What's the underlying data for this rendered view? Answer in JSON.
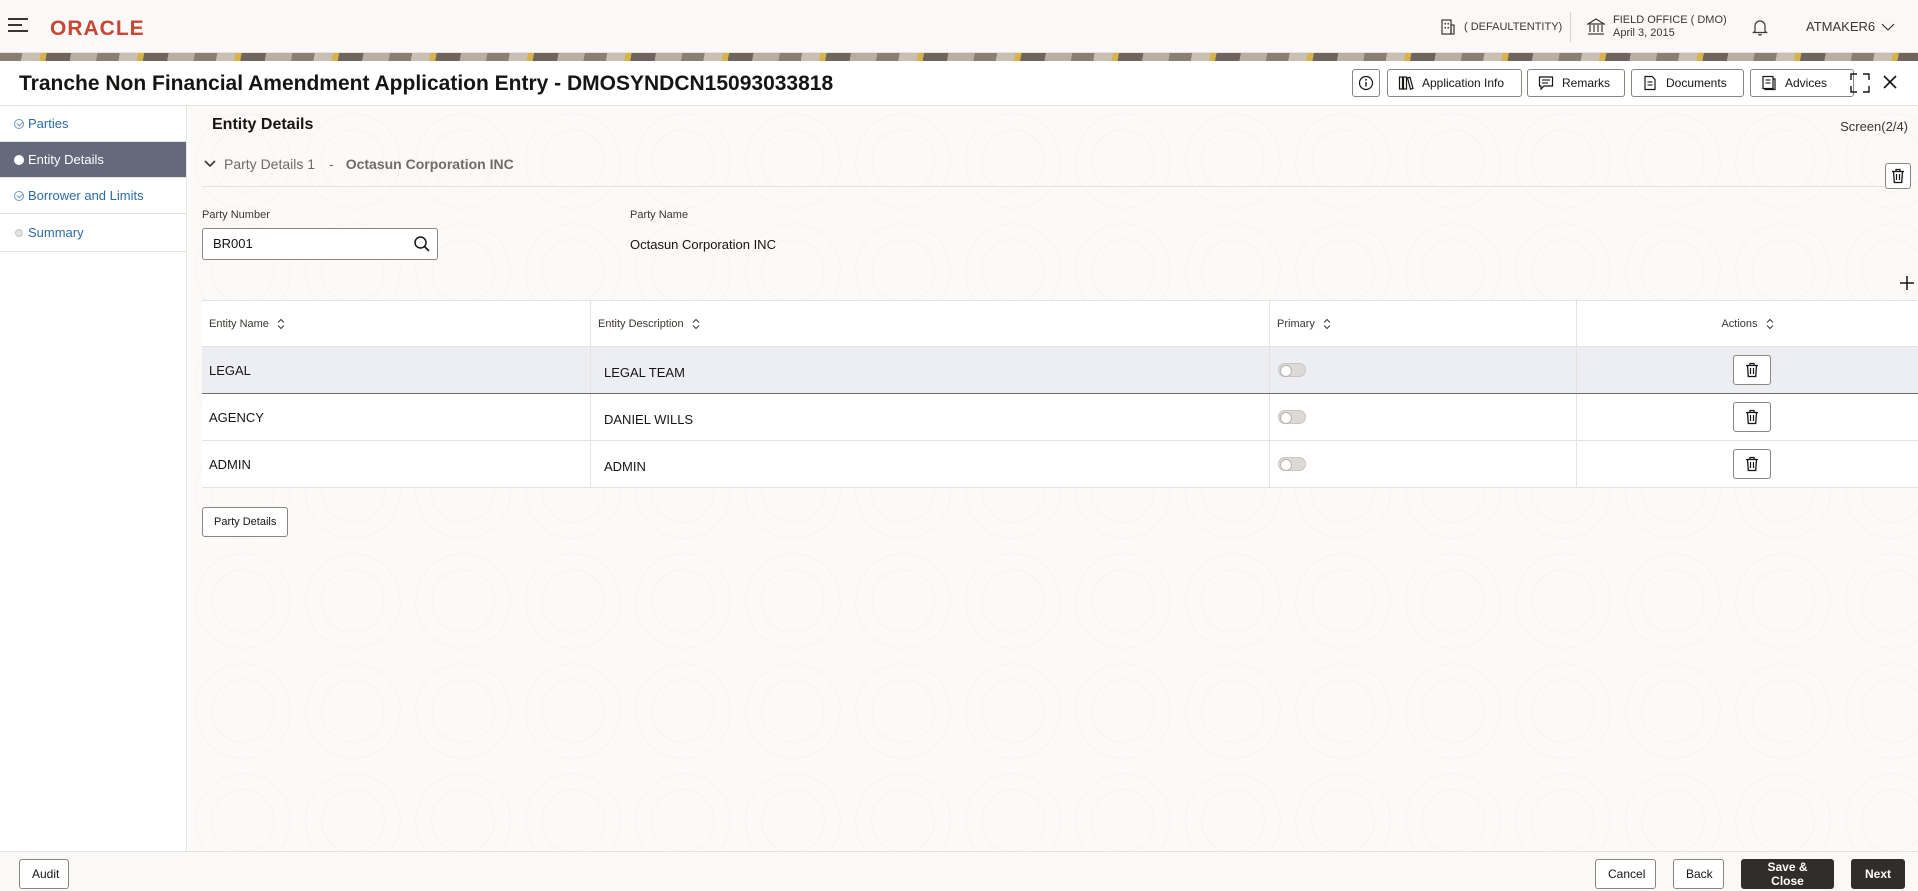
{
  "header": {
    "logo": "ORACLE",
    "entity": "( DEFAULTENTITY)",
    "office_line1": "FIELD OFFICE ( DMO)",
    "office_line2": "April 3, 2015",
    "user": "ATMAKER6"
  },
  "titlebar": {
    "title": "Tranche Non Financial Amendment Application Entry - DMOSYNDCN15093033818",
    "buttons": {
      "application_info": "Application Info",
      "remarks": "Remarks",
      "documents": "Documents",
      "advices": "Advices"
    }
  },
  "sidebar": {
    "items": [
      {
        "label": "Parties",
        "state": "done"
      },
      {
        "label": "Entity Details",
        "state": "active"
      },
      {
        "label": "Borrower and Limits",
        "state": "done"
      },
      {
        "label": "Summary",
        "state": "pending"
      }
    ]
  },
  "main": {
    "section_title": "Entity Details",
    "screen_count": "Screen(2/4)",
    "party_header_label": "Party Details  1",
    "party_header_sep": "-",
    "party_header_name": "Octasun Corporation INC",
    "party_number_label": "Party Number",
    "party_number_value": "BR001",
    "party_name_label": "Party Name",
    "party_name_value": "Octasun Corporation INC",
    "party_details_button": "Party Details"
  },
  "table": {
    "headers": [
      "Entity Name",
      "Entity Description",
      "Primary",
      "Actions"
    ],
    "rows": [
      {
        "name": "LEGAL",
        "description": "LEGAL TEAM",
        "primary": false
      },
      {
        "name": "AGENCY",
        "description": "DANIEL WILLS",
        "primary": false
      },
      {
        "name": "ADMIN",
        "description": "ADMIN",
        "primary": false
      }
    ]
  },
  "footer": {
    "audit": "Audit",
    "cancel": "Cancel",
    "back": "Back",
    "save_close": "Save & Close",
    "next": "Next"
  },
  "colors": {
    "brand": "#c74634",
    "nav_active_bg": "#646a7b",
    "link": "#2b6aa5",
    "primary_button": "#312d2a"
  }
}
